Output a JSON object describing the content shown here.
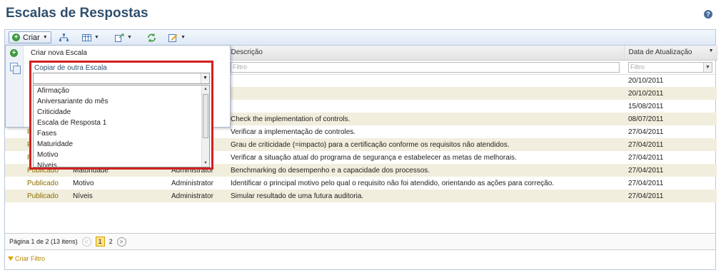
{
  "title": "Escalas de Respostas",
  "help_icon": "question-icon",
  "toolbar": {
    "criar_label": "Criar"
  },
  "menu": {
    "new_label": "Criar nova Escala",
    "copy_label": "Copiar de outra Escala",
    "options": [
      "Afirmação",
      "Aniversariante do mês",
      "Criticidade",
      "Escala de Resposta 1",
      "Fases",
      "Maturidade",
      "Motivo",
      "Níveis"
    ]
  },
  "columns": {
    "descricao": "Descrição",
    "data": "Data de Atualização"
  },
  "filter_placeholder": "Filtro",
  "rows": [
    {
      "status": "",
      "nome": "",
      "autor": "",
      "descricao": "",
      "data": "20/10/2011"
    },
    {
      "status": "",
      "nome": "",
      "autor": "",
      "descricao": "",
      "data": "20/10/2011"
    },
    {
      "status": "Pu",
      "nome": "",
      "autor": "",
      "descricao": "",
      "data": "15/08/2011"
    },
    {
      "status": "En",
      "nome": "",
      "autor": "",
      "descricao": "Check the implementation of controls.",
      "data": "08/07/2011"
    },
    {
      "status": "Pu",
      "nome": "",
      "autor": "",
      "descricao": "Verificar a implementação de controles.",
      "data": "27/04/2011"
    },
    {
      "status": "Publicado",
      "nome": "Criticidade",
      "autor": "Administrator",
      "descricao": "Grau de criticidade (=impacto) para a certificação conforme os requisitos não atendidos.",
      "data": "27/04/2011"
    },
    {
      "status": "Publicado",
      "nome": "Fases",
      "autor": "Administrator",
      "descricao": "Verificar a situação atual do programa de segurança e estabelecer as metas de melhorais.",
      "data": "27/04/2011"
    },
    {
      "status": "Publicado",
      "nome": "Maturidade",
      "autor": "Administrator",
      "descricao": "Benchmarking do desempenho e a capacidade dos processos.",
      "data": "27/04/2011"
    },
    {
      "status": "Publicado",
      "nome": "Motivo",
      "autor": "Administrator",
      "descricao": "Identificar o principal motivo pelo qual o requisito não foi atendido, orientando as ações para correção.",
      "data": "27/04/2011"
    },
    {
      "status": "Publicado",
      "nome": "Níveis",
      "autor": "Administrator",
      "descricao": "Simular resultado de uma futura auditoria.",
      "data": "27/04/2011"
    }
  ],
  "pager": {
    "summary": "Página 1 de 2 (13 itens)",
    "current": "1",
    "next_page": "2",
    "prev": "<",
    "next": ">"
  },
  "criar_filtro": "Criar Filtro"
}
